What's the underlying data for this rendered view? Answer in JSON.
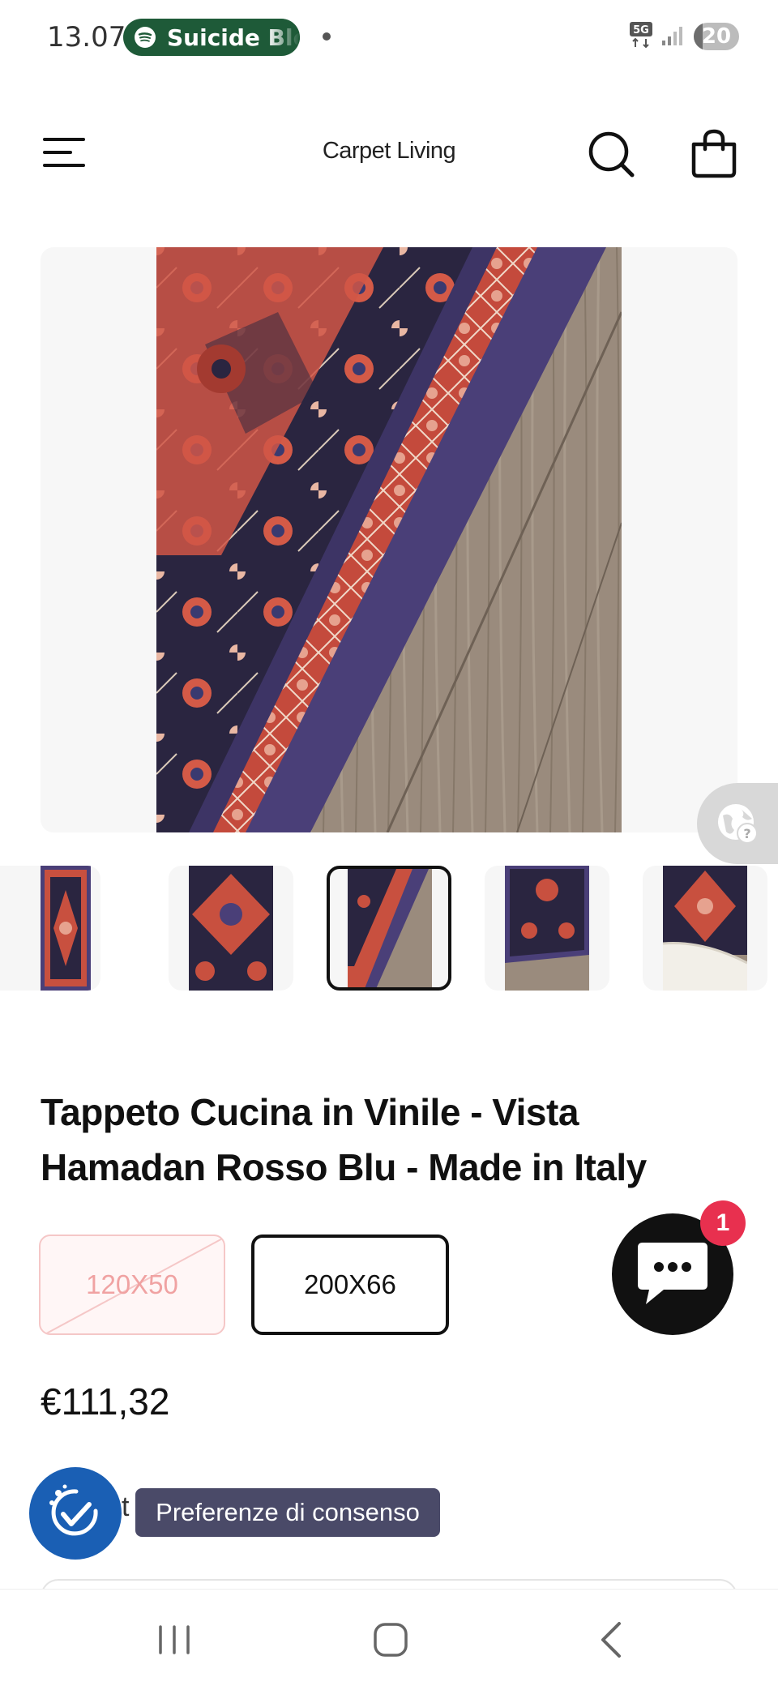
{
  "status_bar": {
    "time": "13.07",
    "media_app_icon": "spotify-icon",
    "media_title": "Suicide Blo",
    "network_label": "5G",
    "battery_percent": 20,
    "battery_text": "20"
  },
  "header": {
    "brand": "Carpet Living",
    "menu_icon": "hamburger-menu-icon",
    "search_icon": "search-icon",
    "cart_icon": "shopping-bag-icon"
  },
  "gallery": {
    "main_image": "rug-detail-on-wood-floor",
    "selected_index": 2,
    "thumbnails": [
      {
        "name": "thumb-full-rug"
      },
      {
        "name": "thumb-pattern-closeup"
      },
      {
        "name": "thumb-corner-on-floor"
      },
      {
        "name": "thumb-rug-on-floor"
      },
      {
        "name": "thumb-rug-curled-edge"
      }
    ],
    "translate_icon": "globe-question-icon"
  },
  "product": {
    "title": "Tappeto Cucina in Vinile - Vista Hamadan Rosso Blu - Made in Italy",
    "sizes": [
      {
        "label": "120X50",
        "available": false
      },
      {
        "label": "200X66",
        "available": true,
        "selected": true
      }
    ],
    "price": "€111,32"
  },
  "chat": {
    "icon": "chat-bubble-icon",
    "badge": "1"
  },
  "consent": {
    "icon": "consent-check-icon",
    "partial_text": "t",
    "tooltip": "Preferenze di consenso"
  },
  "colors": {
    "spotify_pill": "#1e5a38",
    "rug_red": "#c8503f",
    "rug_navy": "#2a2540",
    "rug_purple": "#4a3f78",
    "chat_badge": "#e8304f",
    "consent_blue": "#1a5fb4",
    "tooltip_bg": "#4a4a68"
  },
  "nav_bar": {
    "recent_icon": "recent-apps-icon",
    "home_icon": "home-icon",
    "back_icon": "back-icon"
  }
}
